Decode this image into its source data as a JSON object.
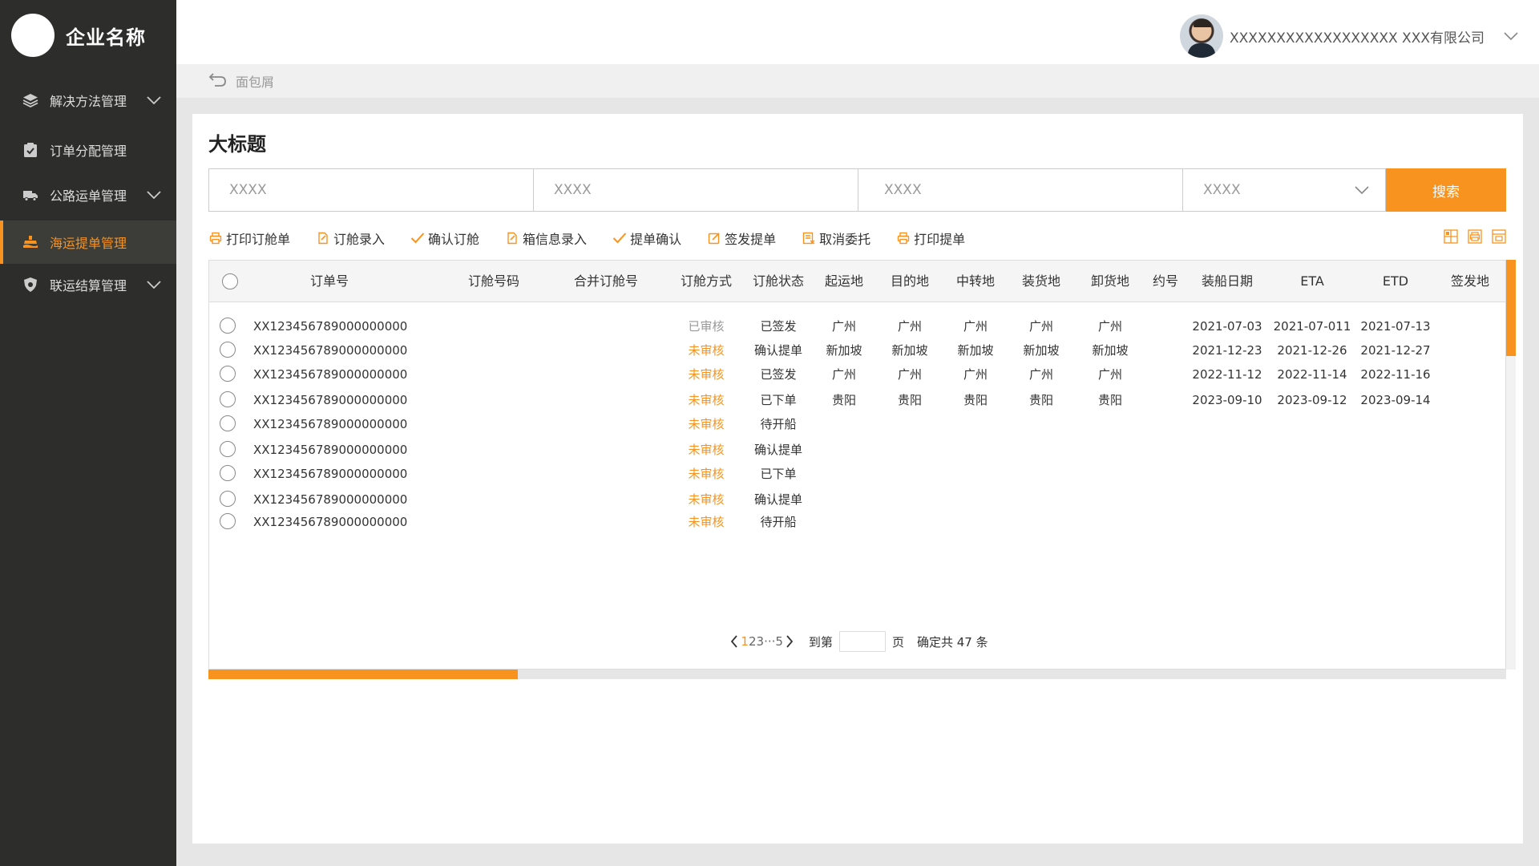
{
  "brand": {
    "name": "企业名称"
  },
  "sidebar": {
    "items": [
      {
        "label": "解决方法管理",
        "icon": "layers-icon",
        "expandable": true,
        "active": false
      },
      {
        "label": "订单分配管理",
        "icon": "clipboard-check-icon",
        "expandable": false,
        "active": false
      },
      {
        "label": "公路运单管理",
        "icon": "truck-icon",
        "expandable": true,
        "active": false
      },
      {
        "label": "海运提单管理",
        "icon": "ship-icon",
        "expandable": false,
        "active": true
      },
      {
        "label": "联运结算管理",
        "icon": "shield-icon",
        "expandable": true,
        "active": false
      }
    ]
  },
  "header": {
    "company": "XXXXXXXXXXXXXXXXXX XXX有限公司"
  },
  "breadcrumb": {
    "text": "面包屑"
  },
  "page": {
    "title": "大标题"
  },
  "search": {
    "field1_placeholder": "XXXX",
    "field2_placeholder": "XXXX",
    "field3_placeholder": "XXXX",
    "select_value": "XXXX",
    "button_label": "搜索"
  },
  "toolbar": {
    "items": [
      {
        "label": "打印订舱单",
        "icon": "print-icon"
      },
      {
        "label": "订舱录入",
        "icon": "document-edit-icon"
      },
      {
        "label": "确认订舱",
        "icon": "check-icon"
      },
      {
        "label": "箱信息录入",
        "icon": "document-edit-icon"
      },
      {
        "label": "提单确认",
        "icon": "check-icon"
      },
      {
        "label": "签发提单",
        "icon": "edit-box-icon"
      },
      {
        "label": "取消委托",
        "icon": "list-cancel-icon"
      },
      {
        "label": "打印提单",
        "icon": "print-icon"
      }
    ]
  },
  "table": {
    "columns": [
      "订单号",
      "订舱号码",
      "合并订舱号",
      "订舱方式",
      "订舱状态",
      "起运地",
      "目的地",
      "中转地",
      "装货地",
      "卸货地",
      "约号",
      "装船日期",
      "ETA",
      "ETD",
      "签发地"
    ],
    "rows": [
      {
        "order_no": "XX123456789000000000",
        "review": "已审核",
        "approved": true,
        "status": "已签发",
        "origin": "广州",
        "destination": "广州",
        "transit": "广州",
        "loading": "广州",
        "unloading": "广州",
        "ship_date": "2021-07-03",
        "eta": "2021-07-011",
        "etd": "2021-07-13"
      },
      {
        "order_no": "XX123456789000000000",
        "review": "未审核",
        "approved": false,
        "status": "确认提单",
        "origin": "新加坡",
        "destination": "新加坡",
        "transit": "新加坡",
        "loading": "新加坡",
        "unloading": "新加坡",
        "ship_date": "2021-12-23",
        "eta": "2021-12-26",
        "etd": "2021-12-27"
      },
      {
        "order_no": "XX123456789000000000",
        "review": "未审核",
        "approved": false,
        "status": "已签发",
        "origin": "广州",
        "destination": "广州",
        "transit": "广州",
        "loading": "广州",
        "unloading": "广州",
        "ship_date": "2022-11-12",
        "eta": "2022-11-14",
        "etd": "2022-11-16"
      },
      {
        "order_no": "XX123456789000000000",
        "review": "未审核",
        "approved": false,
        "status": "已下单",
        "origin": "贵阳",
        "destination": "贵阳",
        "transit": "贵阳",
        "loading": "贵阳",
        "unloading": "贵阳",
        "ship_date": "2023-09-10",
        "eta": "2023-09-12",
        "etd": "2023-09-14"
      },
      {
        "order_no": "XX123456789000000000",
        "review": "未审核",
        "approved": false,
        "status": "待开船",
        "origin": "",
        "destination": "",
        "transit": "",
        "loading": "",
        "unloading": "",
        "ship_date": "",
        "eta": "",
        "etd": ""
      },
      {
        "order_no": "XX123456789000000000",
        "review": "未审核",
        "approved": false,
        "status": "确认提单",
        "origin": "",
        "destination": "",
        "transit": "",
        "loading": "",
        "unloading": "",
        "ship_date": "",
        "eta": "",
        "etd": ""
      },
      {
        "order_no": "XX123456789000000000",
        "review": "未审核",
        "approved": false,
        "status": "已下单",
        "origin": "",
        "destination": "",
        "transit": "",
        "loading": "",
        "unloading": "",
        "ship_date": "",
        "eta": "",
        "etd": ""
      },
      {
        "order_no": "XX123456789000000000",
        "review": "未审核",
        "approved": false,
        "status": "确认提单",
        "origin": "",
        "destination": "",
        "transit": "",
        "loading": "",
        "unloading": "",
        "ship_date": "",
        "eta": "",
        "etd": ""
      },
      {
        "order_no": "XX123456789000000000",
        "review": "未审核",
        "approved": false,
        "status": "待开船",
        "origin": "",
        "destination": "",
        "transit": "",
        "loading": "",
        "unloading": "",
        "ship_date": "",
        "eta": "",
        "etd": ""
      }
    ]
  },
  "pagination": {
    "page1": "1",
    "page2": "2",
    "page3": "3",
    "ellipsis": "···",
    "last": "5",
    "goto_label": "到第",
    "page_unit": "页",
    "summary": "确定共 47 条"
  },
  "colors": {
    "accent": "#f7931e",
    "sidebar_bg": "#2d2d2b"
  }
}
